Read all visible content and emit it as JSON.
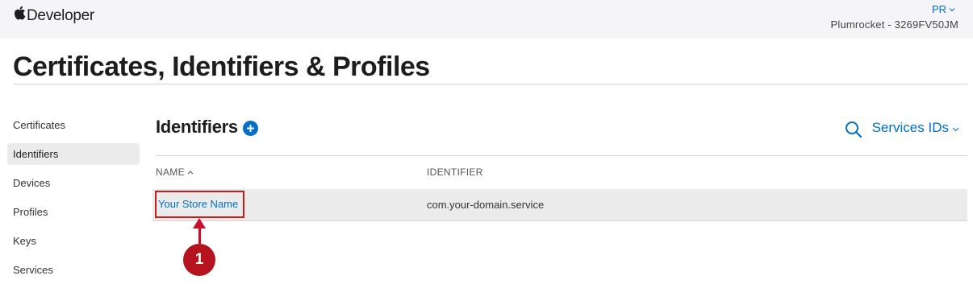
{
  "topbar": {
    "brand": "Developer",
    "account_initials": "PR",
    "team": "Plumrocket - 3269FV50JM"
  },
  "page": {
    "title": "Certificates, Identifiers & Profiles"
  },
  "sidebar": {
    "items": [
      {
        "label": "Certificates",
        "active": false
      },
      {
        "label": "Identifiers",
        "active": true
      },
      {
        "label": "Devices",
        "active": false
      },
      {
        "label": "Profiles",
        "active": false
      },
      {
        "label": "Keys",
        "active": false
      },
      {
        "label": "Services",
        "active": false
      }
    ]
  },
  "main": {
    "section_title": "Identifiers",
    "filter_label": "Services IDs",
    "columns": {
      "name": "NAME",
      "identifier": "IDENTIFIER"
    },
    "rows": [
      {
        "name": "Your Store Name",
        "identifier": "com.your-domain.service"
      }
    ]
  },
  "annotation": {
    "number": "1"
  },
  "colors": {
    "accent": "#0070c9",
    "annotation": "#c8102e",
    "highlight_border": "#cc1a1a",
    "topbar_bg": "#f5f5f7"
  },
  "icons": [
    "apple-logo-icon",
    "chevron-down-icon",
    "add-circle-icon",
    "search-icon",
    "sort-ascending-icon",
    "arrow-up-icon"
  ]
}
